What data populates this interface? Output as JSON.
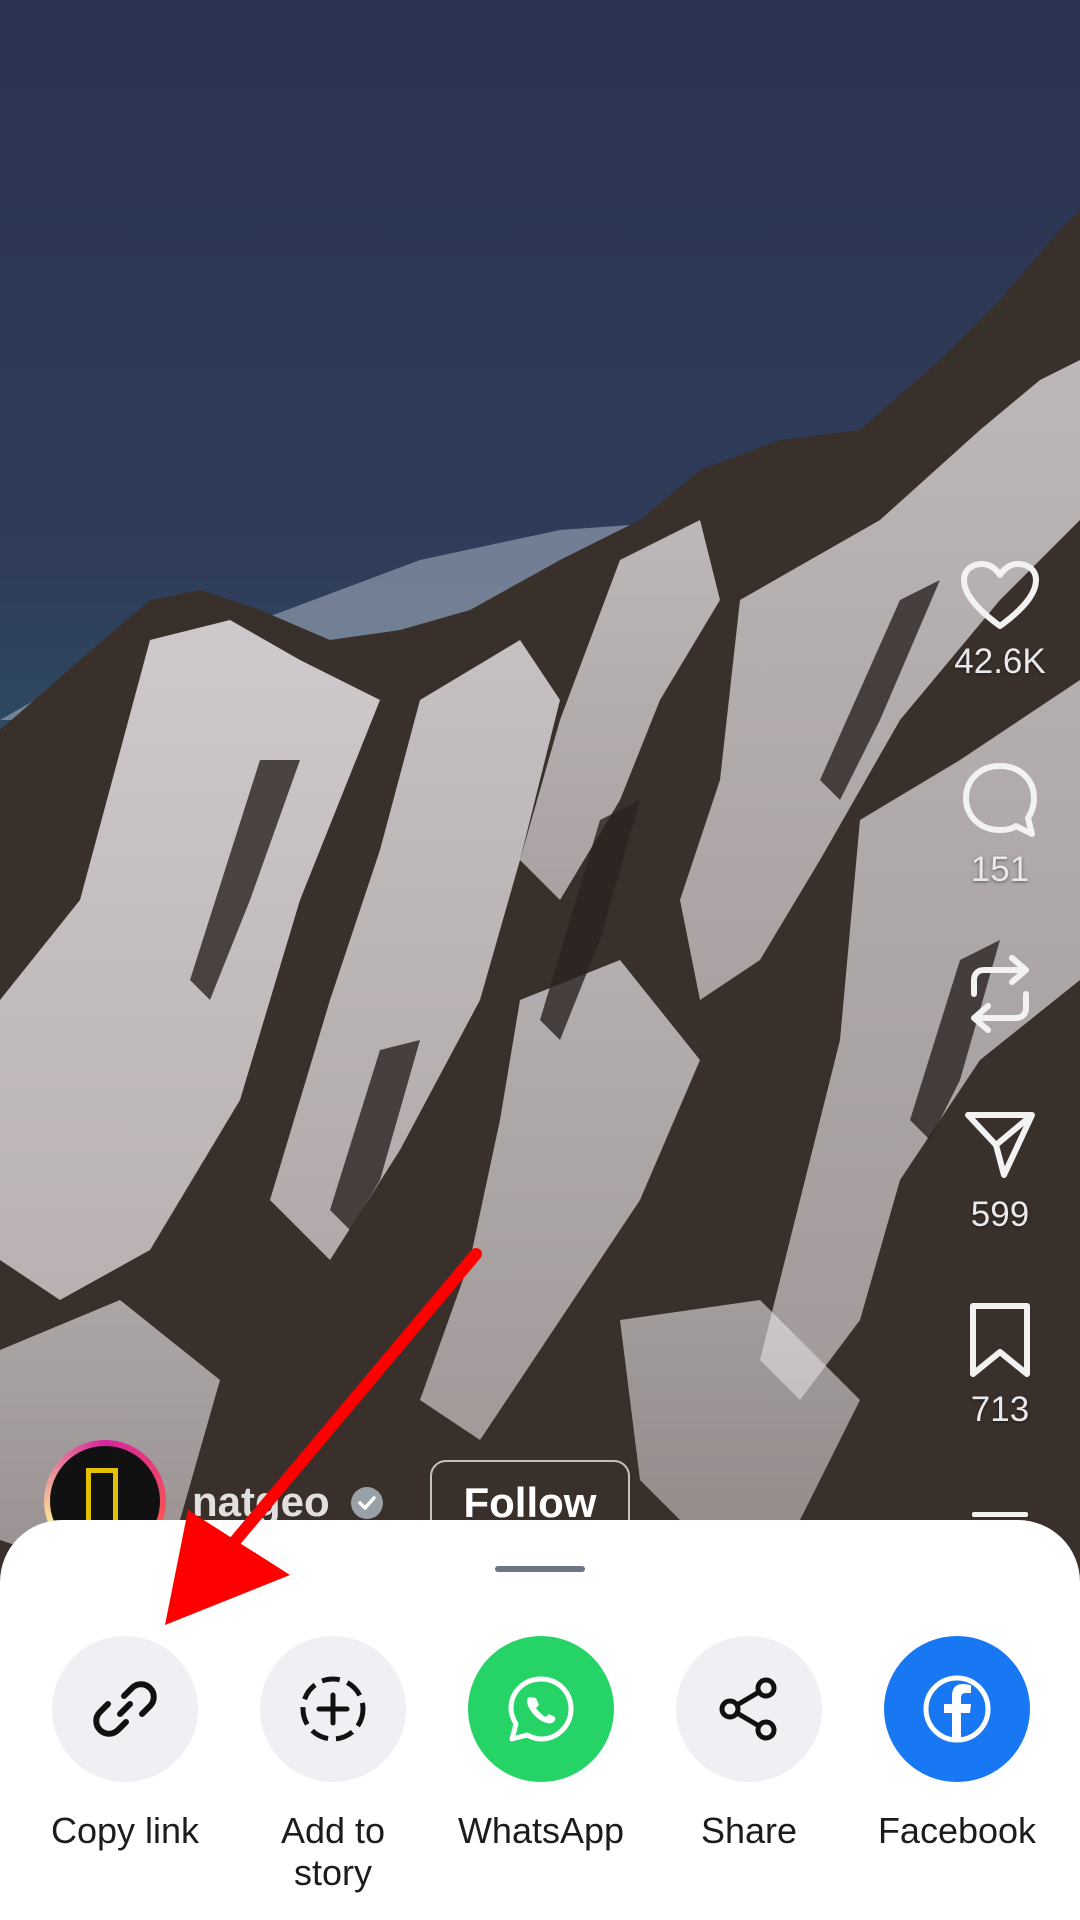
{
  "post": {
    "author_handle": "natgeo",
    "follow_label": "Follow"
  },
  "actions": {
    "likes": "42.6K",
    "comments": "151",
    "shares": "599",
    "saves": "713"
  },
  "share_sheet": {
    "options": [
      {
        "label": "Copy link",
        "icon": "link-icon"
      },
      {
        "label": "Add to story",
        "icon": "add-story-icon"
      },
      {
        "label": "WhatsApp",
        "icon": "whatsapp-icon"
      },
      {
        "label": "Share",
        "icon": "share-icon"
      },
      {
        "label": "Facebook",
        "icon": "facebook-icon"
      }
    ]
  },
  "colors": {
    "whatsapp": "#25d366",
    "facebook": "#1877f2",
    "annotation_arrow": "#ff0000"
  }
}
